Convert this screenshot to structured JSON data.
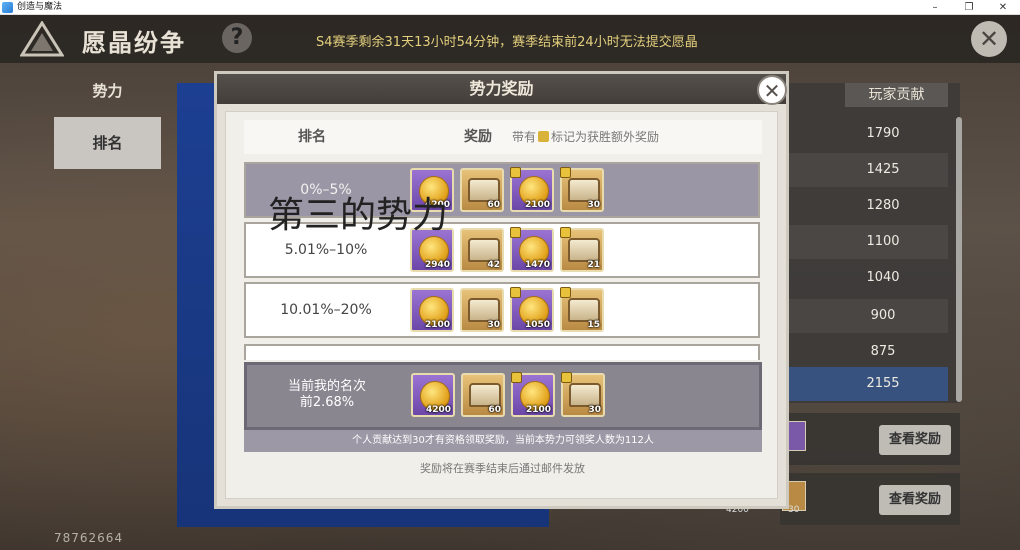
{
  "window": {
    "title": "创造与魔法",
    "min": "–",
    "max": "❐",
    "close": "✕"
  },
  "header": {
    "title": "愿晶纷争",
    "help": "?",
    "season_text": "S4赛季剩余31天13小时54分钟，赛季结束前24小时无法提交愿晶",
    "close": "✕"
  },
  "sidebar": {
    "tabs": [
      {
        "label": "势力"
      },
      {
        "label": "排名"
      }
    ]
  },
  "ranking_panel": {
    "header": "玩家贡献",
    "values": [
      "1790",
      "1425",
      "1280",
      "1100",
      "1040",
      "900",
      "875"
    ],
    "my_value": "2155"
  },
  "reward_buttons": [
    {
      "label": "查看奖励"
    },
    {
      "label": "查看奖励"
    }
  ],
  "partial_items": [
    "4200",
    "30"
  ],
  "uid": "78762664",
  "modal": {
    "title": "势力奖励",
    "close": "✕",
    "col_rank": "排名",
    "col_reward": "奖励",
    "col_note_prefix": "带有",
    "col_note_suffix": "标记为获胜额外奖励",
    "overlay_text": "第三的势力",
    "rows": [
      {
        "label": "0%–5%",
        "items": [
          {
            "type": "coin",
            "bg": "purple",
            "qty": "4200",
            "bonus": false
          },
          {
            "type": "chest",
            "bg": "gold",
            "qty": "60",
            "bonus": false
          },
          {
            "type": "coin",
            "bg": "purple",
            "qty": "2100",
            "bonus": true
          },
          {
            "type": "chest",
            "bg": "gold",
            "qty": "30",
            "bonus": true
          }
        ]
      },
      {
        "label": "5.01%–10%",
        "items": [
          {
            "type": "coin",
            "bg": "purple",
            "qty": "2940",
            "bonus": false
          },
          {
            "type": "chest",
            "bg": "gold",
            "qty": "42",
            "bonus": false
          },
          {
            "type": "coin",
            "bg": "purple",
            "qty": "1470",
            "bonus": true
          },
          {
            "type": "chest",
            "bg": "gold",
            "qty": "21",
            "bonus": true
          }
        ]
      },
      {
        "label": "10.01%–20%",
        "items": [
          {
            "type": "coin",
            "bg": "purple",
            "qty": "2100",
            "bonus": false
          },
          {
            "type": "chest",
            "bg": "gold",
            "qty": "30",
            "bonus": false
          },
          {
            "type": "coin",
            "bg": "purple",
            "qty": "1050",
            "bonus": true
          },
          {
            "type": "chest",
            "bg": "gold",
            "qty": "15",
            "bonus": true
          }
        ]
      }
    ],
    "my_rank": {
      "line1": "当前我的名次",
      "line2": "前2.68%",
      "items": [
        {
          "type": "coin",
          "bg": "purple",
          "qty": "4200",
          "bonus": false
        },
        {
          "type": "chest",
          "bg": "gold",
          "qty": "60",
          "bonus": false
        },
        {
          "type": "coin",
          "bg": "purple",
          "qty": "2100",
          "bonus": true
        },
        {
          "type": "chest",
          "bg": "gold",
          "qty": "30",
          "bonus": true
        }
      ]
    },
    "requirement_note": "个人贡献达到30才有资格领取奖励，当前本势力可领奖人数为112人",
    "footer_note": "奖励将在赛季结束后通过邮件发放"
  }
}
